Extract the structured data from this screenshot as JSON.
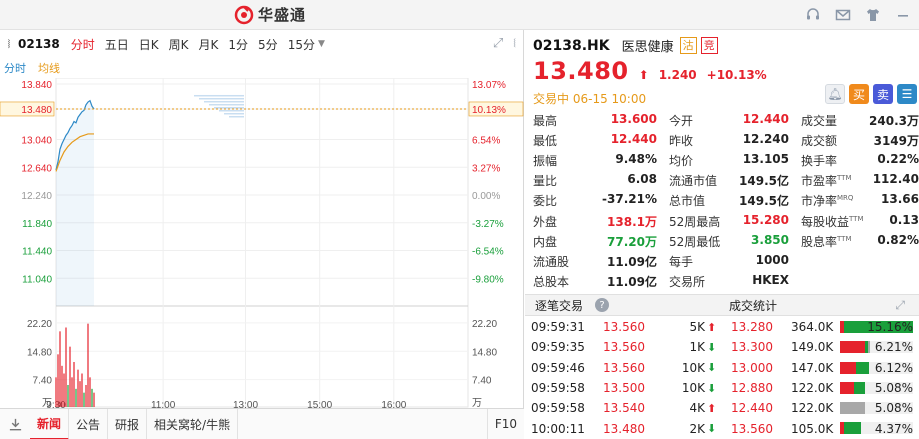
{
  "brand": {
    "name": "华盛通",
    "accent": "#e5222c"
  },
  "titlebar_icons": [
    "headset-icon",
    "mail-icon",
    "shirt-icon",
    "minimize-icon"
  ],
  "toolbar": {
    "code": "02138",
    "periods": [
      "分时",
      "五日",
      "日K",
      "周K",
      "月K",
      "1分",
      "5分",
      "15分"
    ],
    "active_period": "分时"
  },
  "legend": {
    "price": "分时",
    "avg": "均线"
  },
  "colors": {
    "up": "#e5222c",
    "down": "#1a9f3b",
    "price_line": "#2d89c7",
    "avg_line": "#e69a1a"
  },
  "chart_data": {
    "type": "line",
    "title": "",
    "x_ticks": [
      "9:30",
      "11:00",
      "13:00",
      "15:00",
      "16:00"
    ],
    "y_price_ticks": [
      13.84,
      13.48,
      13.04,
      12.64,
      12.24,
      11.84,
      11.44,
      11.04
    ],
    "y_pct_ticks": [
      "13.07%",
      "10.13%",
      "6.54%",
      "3.27%",
      "0.00%",
      "-3.27%",
      "-6.54%",
      "-9.80%"
    ],
    "prev_close": 12.24,
    "current_price_label": "13.480",
    "current_pct_label": "10.13%",
    "ylim": [
      10.64,
      13.84
    ],
    "price": [
      [
        0,
        12.6
      ],
      [
        1,
        12.72
      ],
      [
        2,
        12.9
      ],
      [
        3,
        12.98
      ],
      [
        4,
        13.04
      ],
      [
        5,
        13.1
      ],
      [
        6,
        13.14
      ],
      [
        7,
        13.2
      ],
      [
        8,
        13.24
      ],
      [
        9,
        13.3
      ],
      [
        10,
        13.28
      ],
      [
        11,
        13.36
      ],
      [
        12,
        13.4
      ],
      [
        13,
        13.44
      ],
      [
        14,
        13.46
      ],
      [
        15,
        13.54
      ],
      [
        16,
        13.58
      ],
      [
        17,
        13.6
      ],
      [
        18,
        13.52
      ],
      [
        19,
        13.48
      ]
    ],
    "avg": [
      [
        0,
        12.58
      ],
      [
        2,
        12.74
      ],
      [
        4,
        12.86
      ],
      [
        6,
        12.94
      ],
      [
        8,
        13.0
      ],
      [
        10,
        13.04
      ],
      [
        12,
        13.08
      ],
      [
        14,
        13.1
      ],
      [
        16,
        13.12
      ],
      [
        18,
        13.12
      ],
      [
        19,
        13.12
      ]
    ],
    "volume_ticks": [
      "22.20",
      "14.80",
      "7.40",
      "万"
    ],
    "volume_max": 24,
    "volume": [
      [
        0,
        8,
        1
      ],
      [
        1,
        14,
        1
      ],
      [
        2,
        20,
        1
      ],
      [
        3,
        11,
        1
      ],
      [
        4,
        9,
        1
      ],
      [
        5,
        21,
        1
      ],
      [
        6,
        6,
        0
      ],
      [
        7,
        16,
        1
      ],
      [
        8,
        8,
        1
      ],
      [
        9,
        12,
        1
      ],
      [
        10,
        5,
        0
      ],
      [
        11,
        10,
        1
      ],
      [
        12,
        7,
        1
      ],
      [
        13,
        9,
        1
      ],
      [
        14,
        4,
        0
      ],
      [
        15,
        6,
        1
      ],
      [
        16,
        22,
        1
      ],
      [
        17,
        8,
        1
      ],
      [
        18,
        5,
        0
      ],
      [
        19,
        4,
        1
      ]
    ],
    "minutes_total": 390,
    "minutes_elapsed": 30
  },
  "stock": {
    "code": "02138.HK",
    "name": "医思健康",
    "badge1": "沽",
    "badge2": "竞",
    "price": "13.480",
    "change": "1.240",
    "change_pct": "+10.13%",
    "status": "交易中",
    "datetime": "06-15 10:00"
  },
  "actions": {
    "buy": "买",
    "sell": "卖"
  },
  "quote_rows": [
    [
      {
        "l": "最高",
        "v": "13.600",
        "c": "up"
      },
      {
        "l": "今开",
        "v": "12.440",
        "c": "up"
      },
      {
        "l": "成交量",
        "v": "240.3万",
        "c": ""
      }
    ],
    [
      {
        "l": "最低",
        "v": "12.440",
        "c": "up"
      },
      {
        "l": "昨收",
        "v": "12.240",
        "c": ""
      },
      {
        "l": "成交额",
        "v": "3149万",
        "c": ""
      }
    ],
    [
      {
        "l": "振幅",
        "v": "9.48%",
        "c": ""
      },
      {
        "l": "均价",
        "v": "13.105",
        "c": ""
      },
      {
        "l": "换手率",
        "v": "0.22%",
        "c": ""
      }
    ],
    [
      {
        "l": "量比",
        "v": "6.08",
        "c": ""
      },
      {
        "l": "流通市值",
        "v": "149.5亿",
        "c": ""
      },
      {
        "l": "市盈率",
        "sup": "TTM",
        "v": "112.40",
        "c": ""
      }
    ],
    [
      {
        "l": "委比",
        "v": "-37.21%",
        "c": ""
      },
      {
        "l": "总市值",
        "v": "149.5亿",
        "c": ""
      },
      {
        "l": "市净率",
        "sup": "MRQ",
        "v": "13.66",
        "c": ""
      }
    ],
    [
      {
        "l": "外盘",
        "v": "138.1万",
        "c": "up"
      },
      {
        "l": "52周最高",
        "v": "15.280",
        "c": "up"
      },
      {
        "l": "每股收益",
        "sup": "TTM",
        "v": "0.13",
        "c": ""
      }
    ],
    [
      {
        "l": "内盘",
        "v": "77.20万",
        "c": "down"
      },
      {
        "l": "52周最低",
        "v": "3.850",
        "c": "down"
      },
      {
        "l": "股息率",
        "sup": "TTM",
        "v": "0.82%",
        "c": ""
      }
    ],
    [
      {
        "l": "流通股",
        "v": "11.09亿",
        "c": ""
      },
      {
        "l": "每手",
        "v": "1000",
        "c": ""
      },
      {
        "l": "",
        "v": "",
        "c": ""
      }
    ],
    [
      {
        "l": "总股本",
        "v": "11.09亿",
        "c": ""
      },
      {
        "l": "交易所",
        "v": "HKEX",
        "c": ""
      },
      {
        "l": "",
        "v": "",
        "c": ""
      }
    ]
  ],
  "section": {
    "trades_title": "逐笔交易",
    "stats_title": "成交统计"
  },
  "trades": [
    {
      "time": "09:59:31",
      "price": "13.560",
      "vol": "5K",
      "dir": "up"
    },
    {
      "time": "09:59:35",
      "price": "13.560",
      "vol": "1K",
      "dir": "down"
    },
    {
      "time": "09:59:46",
      "price": "13.560",
      "vol": "10K",
      "dir": "down"
    },
    {
      "time": "09:59:58",
      "price": "13.500",
      "vol": "10K",
      "dir": "down"
    },
    {
      "time": "09:59:58",
      "price": "13.540",
      "vol": "4K",
      "dir": "up"
    },
    {
      "time": "10:00:11",
      "price": "13.480",
      "vol": "2K",
      "dir": "down"
    }
  ],
  "stats": [
    {
      "price": "13.280",
      "vol": "364.0K",
      "pct": "15.16%",
      "share": 1.0,
      "red": 0.05,
      "green": 0.95,
      "grey": 0
    },
    {
      "price": "13.300",
      "vol": "149.0K",
      "pct": "6.21%",
      "share": 0.41,
      "red": 0.85,
      "green": 0.1,
      "grey": 0.05
    },
    {
      "price": "13.000",
      "vol": "147.0K",
      "pct": "6.12%",
      "share": 0.4,
      "red": 0.55,
      "green": 0.45,
      "grey": 0
    },
    {
      "price": "12.880",
      "vol": "122.0K",
      "pct": "5.08%",
      "share": 0.34,
      "red": 0.55,
      "green": 0.45,
      "grey": 0
    },
    {
      "price": "12.440",
      "vol": "122.0K",
      "pct": "5.08%",
      "share": 0.34,
      "red": 0,
      "green": 0,
      "grey": 1
    },
    {
      "price": "13.560",
      "vol": "105.0K",
      "pct": "4.37%",
      "share": 0.29,
      "red": 0.2,
      "green": 0.8,
      "grey": 0
    }
  ],
  "bottom_tabs": [
    "新闻",
    "公告",
    "研报",
    "相关窝轮/牛熊"
  ],
  "bottom_active": "新闻",
  "f10": "F10"
}
